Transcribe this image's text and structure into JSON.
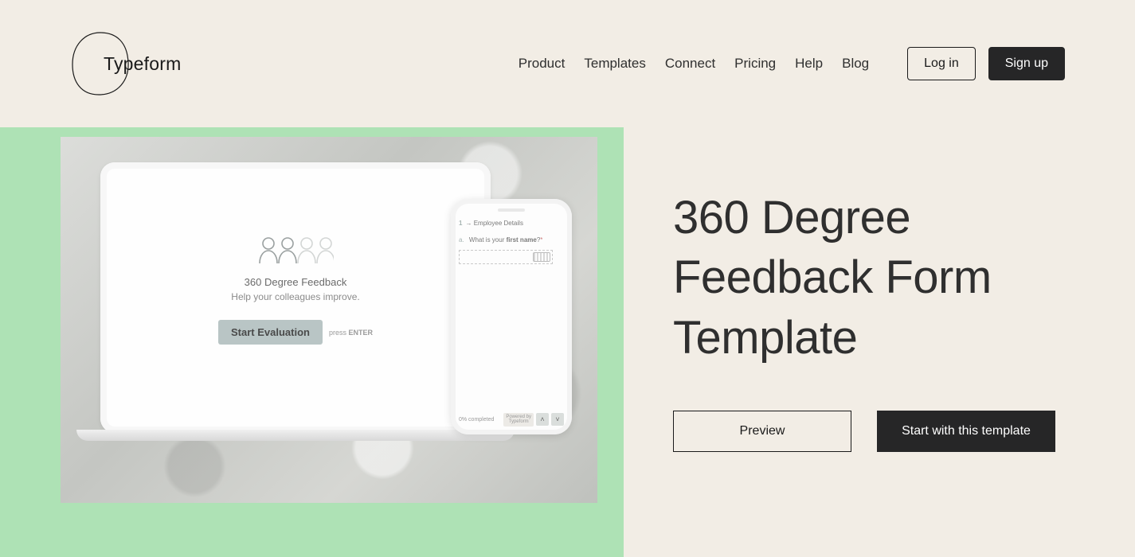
{
  "brand": {
    "name": "Typeform"
  },
  "nav": {
    "items": [
      "Product",
      "Templates",
      "Connect",
      "Pricing",
      "Help",
      "Blog"
    ]
  },
  "auth": {
    "login": "Log in",
    "signup": "Sign up"
  },
  "hero": {
    "title": "360 Degree Feedback Form Template",
    "preview_label": "Preview",
    "start_label": "Start with this template"
  },
  "demo": {
    "laptop": {
      "title": "360 Degree Feedback",
      "subtitle": "Help your colleagues improve.",
      "button": "Start Evaluation",
      "hint_prefix": "press",
      "hint_key": "ENTER"
    },
    "phone": {
      "section_num": "1",
      "section_arrow": "→",
      "section_label": "Employee Details",
      "q_bullet": "a.",
      "q_text_before": "What is your ",
      "q_text_bold": "first name",
      "q_text_after": "?",
      "required": "*",
      "footer_progress": "0% completed",
      "powered_line1": "Powered by",
      "powered_line2": "Typeform",
      "arrow_up": "˄",
      "arrow_down": "˅"
    }
  }
}
